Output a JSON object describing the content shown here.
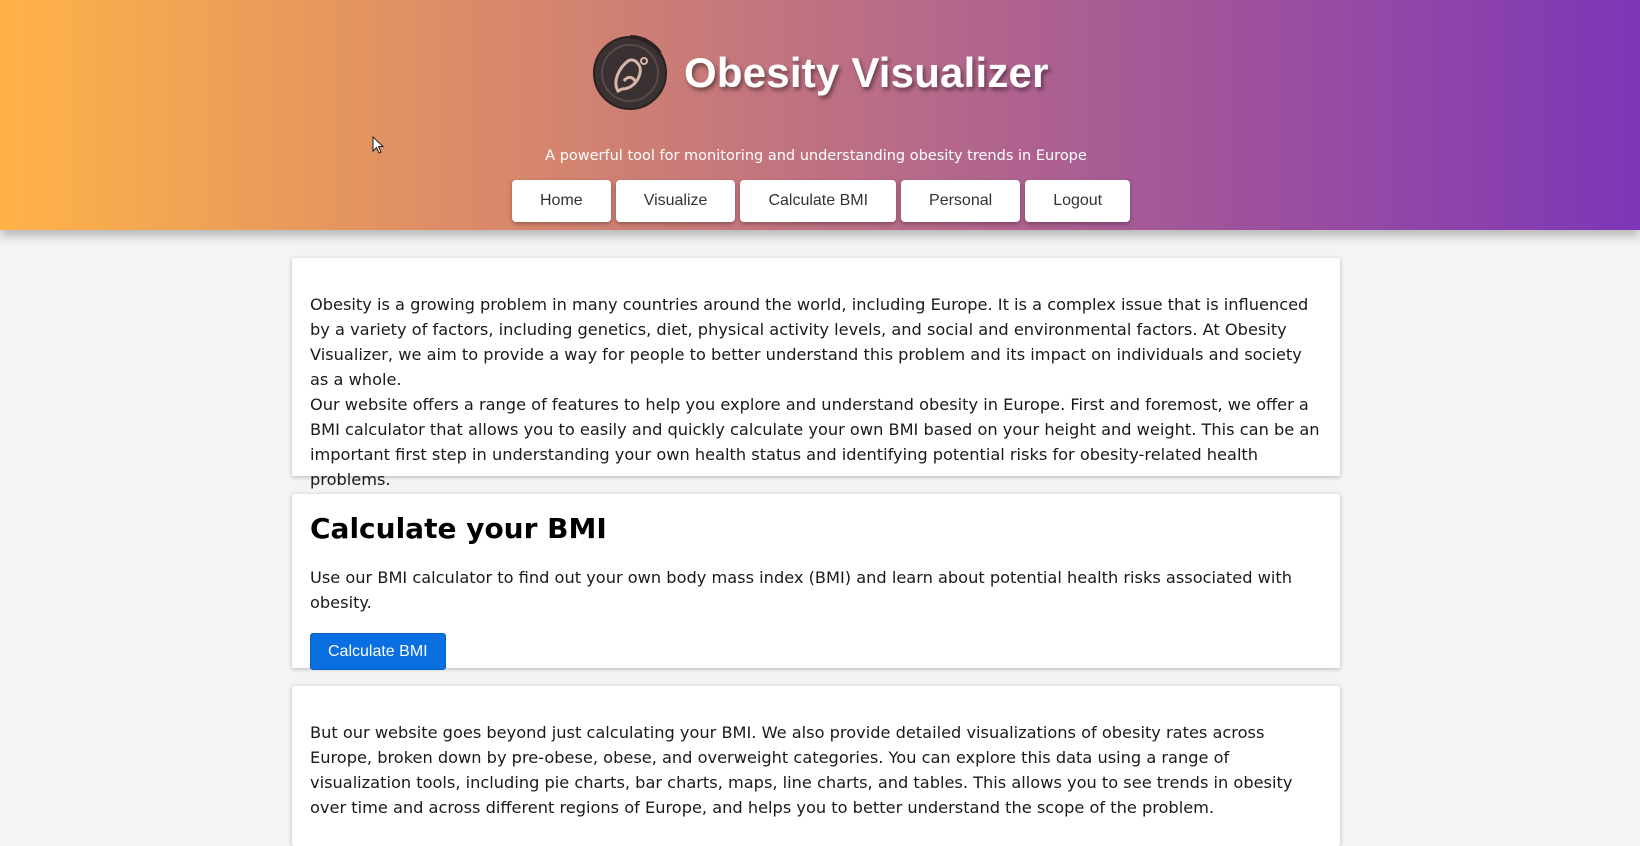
{
  "header": {
    "title": "Obesity Visualizer",
    "subtitle": "A powerful tool for monitoring and understanding obesity trends in Europe",
    "logo_icon": "runner-circle-icon",
    "gradient_colors": [
      "#ffb347",
      "#d9896a",
      "#b86b88",
      "#9b4f9e",
      "#7d36b8"
    ]
  },
  "nav": {
    "items": [
      {
        "label": "Home"
      },
      {
        "label": "Visualize"
      },
      {
        "label": "Calculate BMI"
      },
      {
        "label": "Personal"
      },
      {
        "label": "Logout"
      }
    ]
  },
  "intro": {
    "p1": "Obesity is a growing problem in many countries around the world, including Europe. It is a complex issue that is influenced by a variety of factors, including genetics, diet, physical activity levels, and social and environmental factors. At Obesity Visualizer, we aim to provide a way for people to better understand this problem and its impact on individuals and society as a whole.",
    "p2": "Our website offers a range of features to help you explore and understand obesity in Europe. First and foremost, we offer a BMI calculator that allows you to easily and quickly calculate your own BMI based on your height and weight. This can be an important first step in understanding your own health status and identifying potential risks for obesity-related health problems."
  },
  "bmi": {
    "heading": "Calculate your BMI",
    "text": "Use our BMI calculator to find out your own body mass index (BMI) and learn about potential health risks associated with obesity.",
    "button_label": "Calculate BMI",
    "button_color": "#0a6fe0"
  },
  "visualize": {
    "p1": "But our website goes beyond just calculating your BMI. We also provide detailed visualizations of obesity rates across Europe, broken down by pre-obese, obese, and overweight categories. You can explore this data using a range of visualization tools, including pie charts, bar charts, maps, line charts, and tables. This allows you to see trends in obesity over time and across different regions of Europe, and helps you to better understand the scope of the problem."
  }
}
